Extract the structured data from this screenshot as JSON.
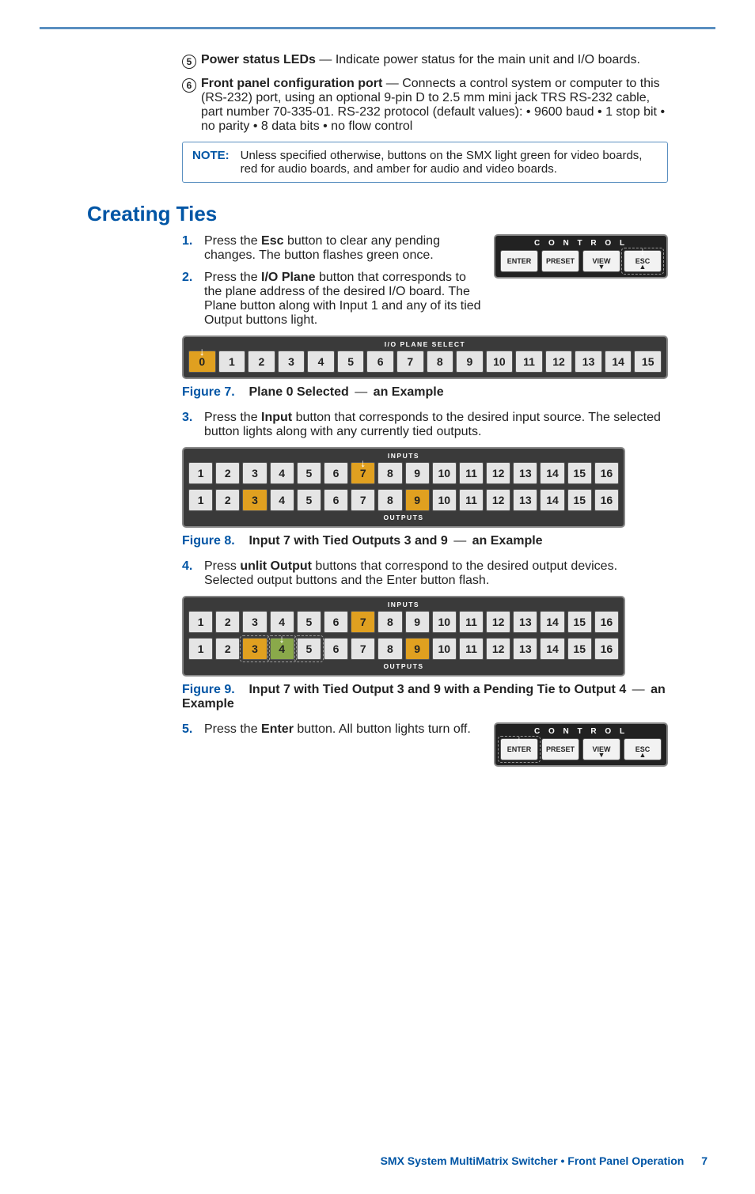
{
  "items": [
    {
      "marker": "5",
      "bold": "Power status LEDs",
      "text": " — Indicate power status for the main unit and I/O boards."
    },
    {
      "marker": "6",
      "bold": "Front panel configuration port",
      "text": " — Connects a control system or computer to this (RS-232) port, using an optional 9-pin D to 2.5 mm mini jack TRS RS-232 cable, part number 70-335-01. RS-232 protocol (default values): • 9600 baud   • 1 stop bit   • no parity • 8 data bits   • no flow control"
    }
  ],
  "note": {
    "label": "NOTE:",
    "text": "Unless specified otherwise, buttons on the SMX light green for video boards, red for audio boards, and amber for audio and video boards."
  },
  "section_title": "Creating Ties",
  "steps": [
    {
      "num": "1.",
      "pre": "Press the ",
      "bold": "Esc",
      "post": " button to clear any pending changes. The button flashes green once."
    },
    {
      "num": "2.",
      "pre": "Press the ",
      "bold": "I/O Plane",
      "post": " button that corresponds to the plane address of the desired I/O board. The Plane button along with Input 1 and any of its tied Output buttons light."
    },
    {
      "num": "3.",
      "pre": "Press the ",
      "bold": "Input",
      "post": " button that corresponds to the desired input source. The selected button lights along with any currently tied outputs."
    },
    {
      "num": "4.",
      "pre": "Press ",
      "bold": "unlit Output",
      "post": " buttons that correspond to the desired output devices. Selected output buttons and the Enter button flash."
    },
    {
      "num": "5.",
      "pre": "Press the ",
      "bold": "Enter",
      "post": " button. All button lights turn off."
    }
  ],
  "figures": {
    "f7": {
      "label": "Figure 7.",
      "bold1": "Plane 0 Selected",
      "dash": " — ",
      "bold2": "an Example"
    },
    "f8": {
      "label": "Figure 8.",
      "bold1": "Input 7 with Tied Outputs 3 and 9",
      "dash": " — ",
      "bold2": "an Example"
    },
    "f9": {
      "label": "Figure 9.",
      "bold1": "Input 7 with Tied Output 3 and 9 with a Pending Tie to Output 4",
      "dash": " — ",
      "bold2": "an Example"
    }
  },
  "control": {
    "title": "C O N T R O L",
    "buttons": [
      "ENTER",
      "PRESET",
      "VIEW",
      "ESC"
    ]
  },
  "plane_strip": {
    "title": "I/O PLANE SELECT",
    "cells": [
      "0",
      "1",
      "2",
      "3",
      "4",
      "5",
      "6",
      "7",
      "8",
      "9",
      "10",
      "11",
      "12",
      "13",
      "14",
      "15"
    ],
    "lit_amber": [
      0
    ],
    "pointer_at": 0
  },
  "io_strip_a": {
    "title_top": "INPUTS",
    "title_bottom": "OUTPUTS",
    "cells": [
      "1",
      "2",
      "3",
      "4",
      "5",
      "6",
      "7",
      "8",
      "9",
      "10",
      "11",
      "12",
      "13",
      "14",
      "15",
      "16"
    ],
    "inputs_lit_amber": [
      6
    ],
    "inputs_pointer_at": 6,
    "outputs_lit_amber": [
      2,
      8
    ]
  },
  "io_strip_b": {
    "title_top": "INPUTS",
    "title_bottom": "OUTPUTS",
    "cells": [
      "1",
      "2",
      "3",
      "4",
      "5",
      "6",
      "7",
      "8",
      "9",
      "10",
      "11",
      "12",
      "13",
      "14",
      "15",
      "16"
    ],
    "inputs_lit_amber": [
      6
    ],
    "outputs_lit_amber": [
      2,
      8
    ],
    "outputs_lit_green": [
      3
    ],
    "outputs_ring_at": [
      2,
      3,
      4
    ],
    "outputs_pointer_at": 3
  },
  "footer": {
    "text": "SMX System MultiMatrix Switcher • Front Panel Operation",
    "page": "7"
  }
}
